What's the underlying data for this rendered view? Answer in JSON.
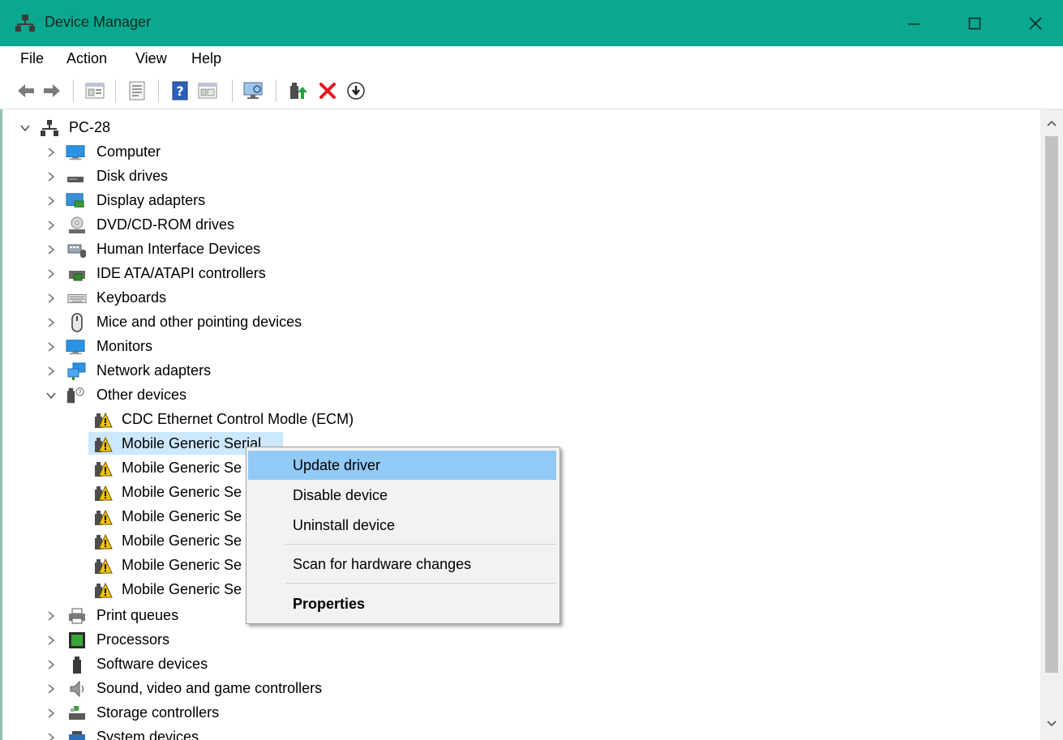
{
  "window": {
    "title": "Device Manager"
  },
  "menu": [
    "File",
    "Action",
    "View",
    "Help"
  ],
  "toolbar": {
    "icons": [
      "back-arrow-icon",
      "forward-arrow-icon",
      "properties-icon",
      "show-hidden-icon",
      "help-icon",
      "details-icon",
      "monitor-icon",
      "update-driver-icon",
      "uninstall-icon",
      "download-icon"
    ]
  },
  "tree": {
    "root": "PC-28",
    "categories": [
      "Computer",
      "Disk drives",
      "Display adapters",
      "DVD/CD-ROM drives",
      "Human Interface Devices",
      "IDE ATA/ATAPI controllers",
      "Keyboards",
      "Mice and other pointing devices",
      "Monitors",
      "Network adapters",
      "Other devices"
    ],
    "other_devices": [
      "CDC Ethernet Control Modle (ECM)",
      "Mobile Generic Serial",
      "Mobile Generic Se",
      "Mobile Generic Se",
      "Mobile Generic Se",
      "Mobile Generic Se",
      "Mobile Generic Se",
      "Mobile Generic Se"
    ],
    "categories_after": [
      "Print queues",
      "Processors",
      "Software devices",
      "Sound, video and game controllers",
      "Storage controllers",
      "System devices"
    ]
  },
  "context_menu": {
    "items": [
      "Update driver",
      "Disable device",
      "Uninstall device",
      "Scan for hardware changes",
      "Properties"
    ]
  }
}
